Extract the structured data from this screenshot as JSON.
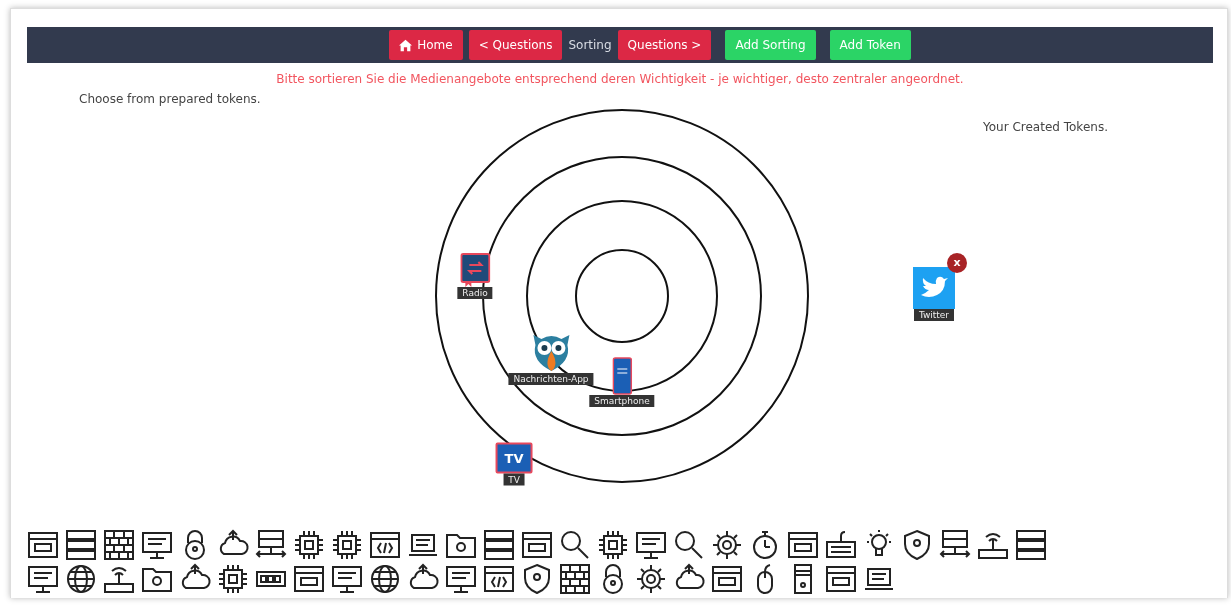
{
  "nav": {
    "buttons": [
      {
        "label": "Home",
        "kind": "home"
      },
      {
        "label": "< Questions",
        "kind": "nav"
      },
      {
        "label": "Sorting",
        "kind": "current"
      },
      {
        "label": "Questions >",
        "kind": "nav"
      },
      {
        "label": "Add Sorting",
        "kind": "add"
      },
      {
        "label": "Add Token",
        "kind": "add"
      }
    ]
  },
  "instruction": "Bitte sortieren Sie die Medienangebote entsprechend deren Wichtigkeit - je wichtiger, desto zentraler angeordnet.",
  "prepared_tokens": {
    "heading": "Choose from prepared tokens."
  },
  "sorting_board": {
    "tokens": [
      {
        "label": "Radio",
        "kind": "radio"
      },
      {
        "label": "Nachrichten-App",
        "kind": "owl"
      },
      {
        "label": "Smartphone",
        "kind": "phone"
      },
      {
        "label": "TV",
        "kind": "tv",
        "icon_text": "TV"
      }
    ]
  },
  "created_tokens": {
    "heading": "Your Created Tokens.",
    "tokens": [
      {
        "label": "Twitter",
        "kind": "bird",
        "remove": "x"
      }
    ]
  }
}
